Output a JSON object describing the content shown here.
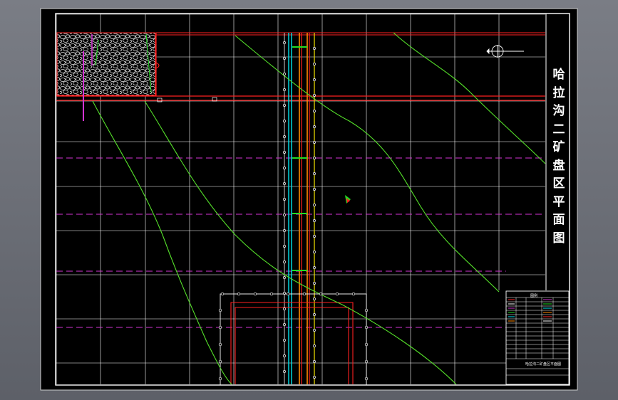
{
  "drawing": {
    "title_chars": [
      "哈",
      "拉",
      "沟",
      "二",
      "矿",
      "盘",
      "区",
      "平",
      "面",
      "图"
    ],
    "legend_header": "图例",
    "legend_footer": "哈拉沟二矿盘区平面图",
    "colors": {
      "grid": "#ffffff",
      "frame": "#ffffff",
      "roadway": "#ff2020",
      "contour": "#55e02a",
      "dashed_boundary": "#d433d4",
      "cyan_tube": "#00e5ee",
      "orange_tube": "#ff8a00",
      "yellow_tube": "#f2e600",
      "green_marker": "#22dd22"
    }
  }
}
